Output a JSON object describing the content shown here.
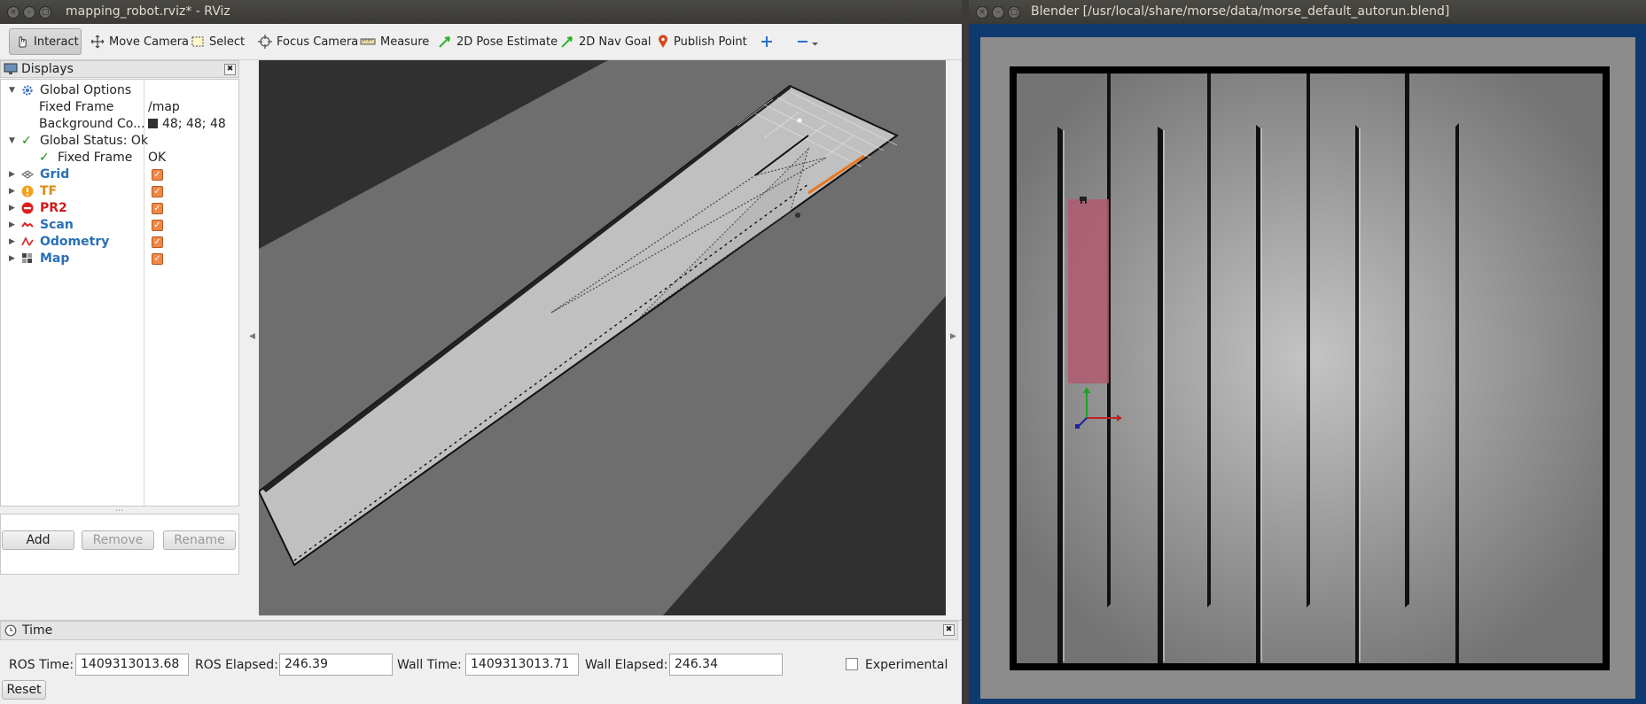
{
  "rviz": {
    "title": "mapping_robot.rviz* - RViz",
    "toolbar": {
      "interact": "Interact",
      "move_camera": "Move Camera",
      "select": "Select",
      "focus_camera": "Focus Camera",
      "measure": "Measure",
      "pose_estimate": "2D Pose Estimate",
      "nav_goal": "2D Nav Goal",
      "publish_point": "Publish Point"
    },
    "displays": {
      "title": "Displays",
      "global_options": "Global Options",
      "fixed_frame_label": "Fixed Frame",
      "fixed_frame_value": "/map",
      "background_label": "Background Co...",
      "background_value": "48; 48; 48",
      "global_status": "Global Status: Ok",
      "status_fixed_frame": "Fixed Frame",
      "status_fixed_frame_value": "OK",
      "items": [
        {
          "label": "Grid",
          "checked": true
        },
        {
          "label": "TF",
          "checked": true
        },
        {
          "label": "PR2",
          "checked": true
        },
        {
          "label": "Scan",
          "checked": true
        },
        {
          "label": "Odometry",
          "checked": true
        },
        {
          "label": "Map",
          "checked": true
        }
      ],
      "add": "Add",
      "remove": "Remove",
      "rename": "Rename"
    },
    "time": {
      "title": "Time",
      "ros_time_label": "ROS Time:",
      "ros_time": "1409313013.68",
      "ros_elapsed_label": "ROS Elapsed:",
      "ros_elapsed": "246.39",
      "wall_time_label": "Wall Time:",
      "wall_time": "1409313013.71",
      "wall_elapsed_label": "Wall Elapsed:",
      "wall_elapsed": "246.34",
      "experimental": "Experimental",
      "reset": "Reset"
    }
  },
  "blender": {
    "title": "Blender [/usr/local/share/morse/data/morse_default_autorun.blend]"
  },
  "colors": {
    "rviz_background": "#303030",
    "map_free": "#c0c0c0",
    "map_unknown": "#6e6e6e",
    "laser_scan": "#e8761e",
    "blender_frame": "#0e3a70",
    "robot_area": "#b05a70"
  }
}
